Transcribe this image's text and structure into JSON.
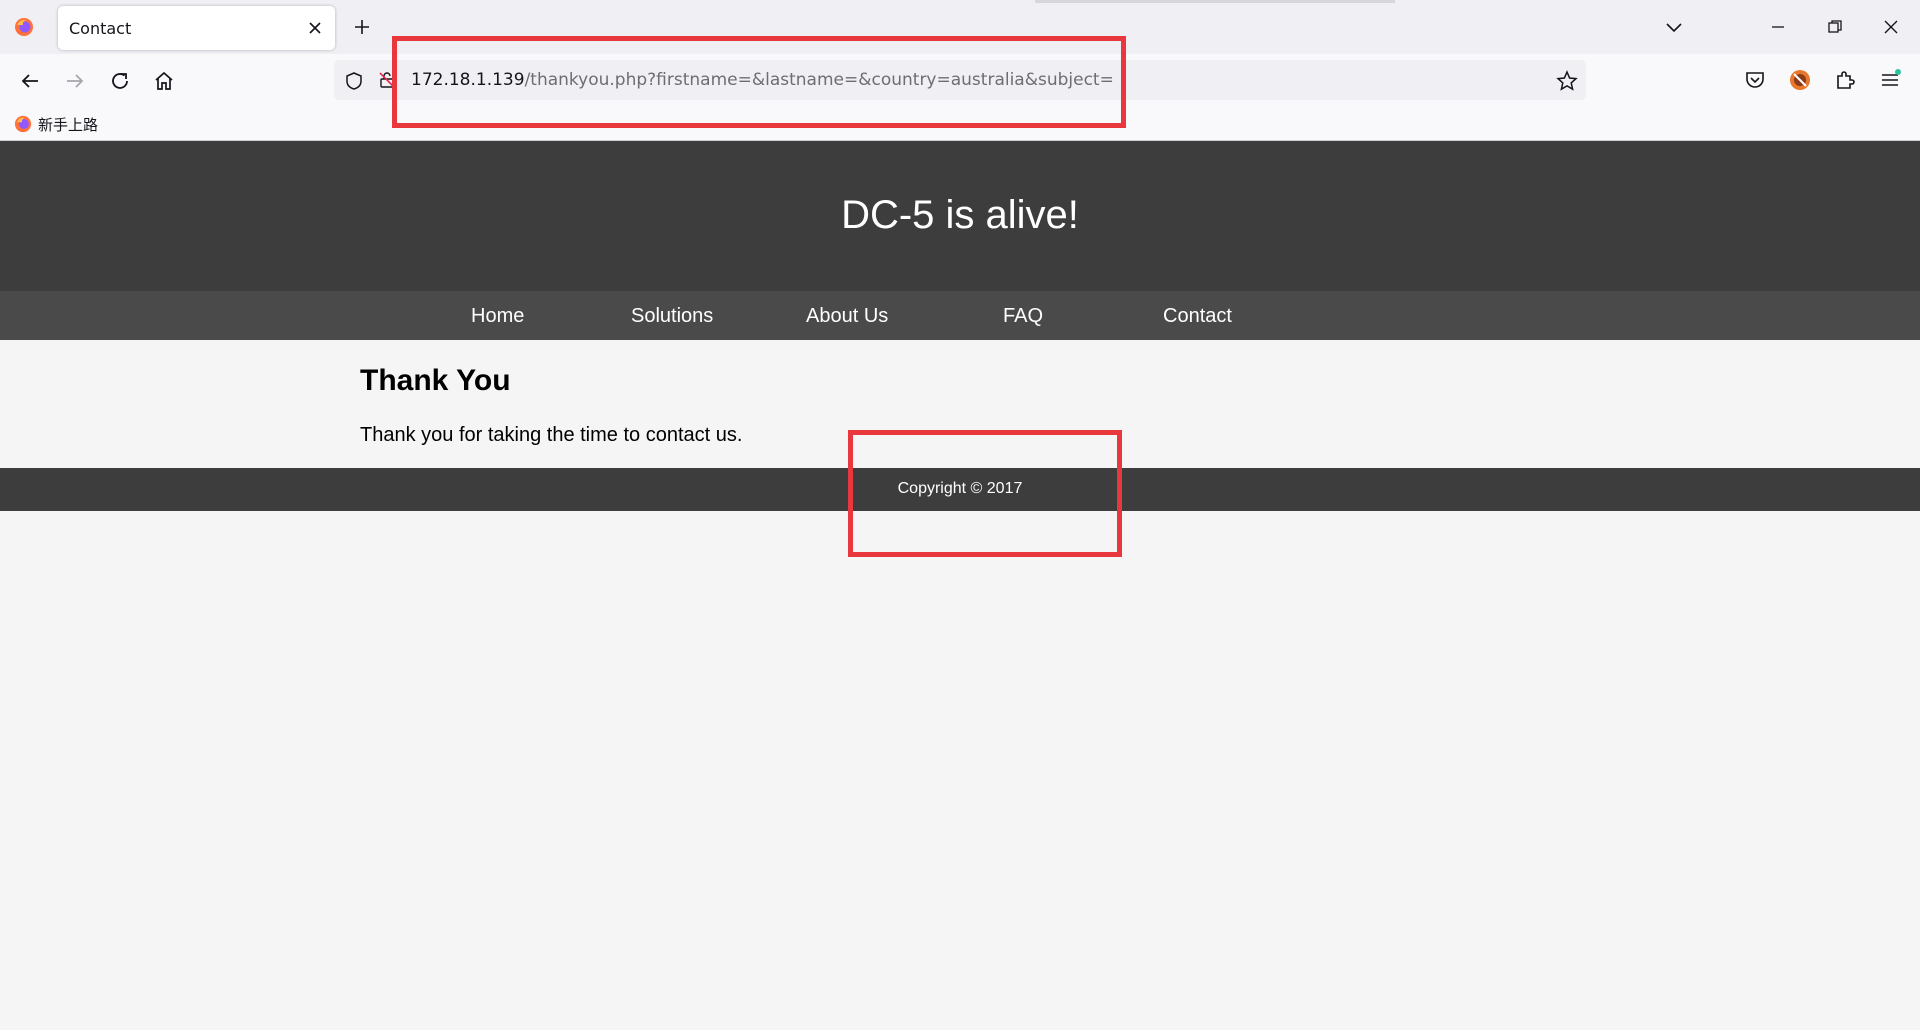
{
  "browser": {
    "tab": {
      "title": "Contact"
    },
    "url": {
      "host": "172.18.1.139",
      "path": "/thankyou.php?firstname=&lastname=&country=australia&subject="
    },
    "bookmarks": [
      {
        "label": "新手上路"
      }
    ]
  },
  "site": {
    "title": "DC-5 is alive!",
    "nav": [
      {
        "label": "Home"
      },
      {
        "label": "Solutions"
      },
      {
        "label": "About Us"
      },
      {
        "label": "FAQ"
      },
      {
        "label": "Contact"
      }
    ],
    "heading": "Thank You",
    "message": "Thank you for taking the time to contact us.",
    "footer": "Copyright © 2017"
  },
  "colors": {
    "header_bg": "#3d3d3d",
    "nav_bg": "#4a4a4a",
    "page_bg": "#f5f5f5",
    "annotation": "#e8383d"
  }
}
